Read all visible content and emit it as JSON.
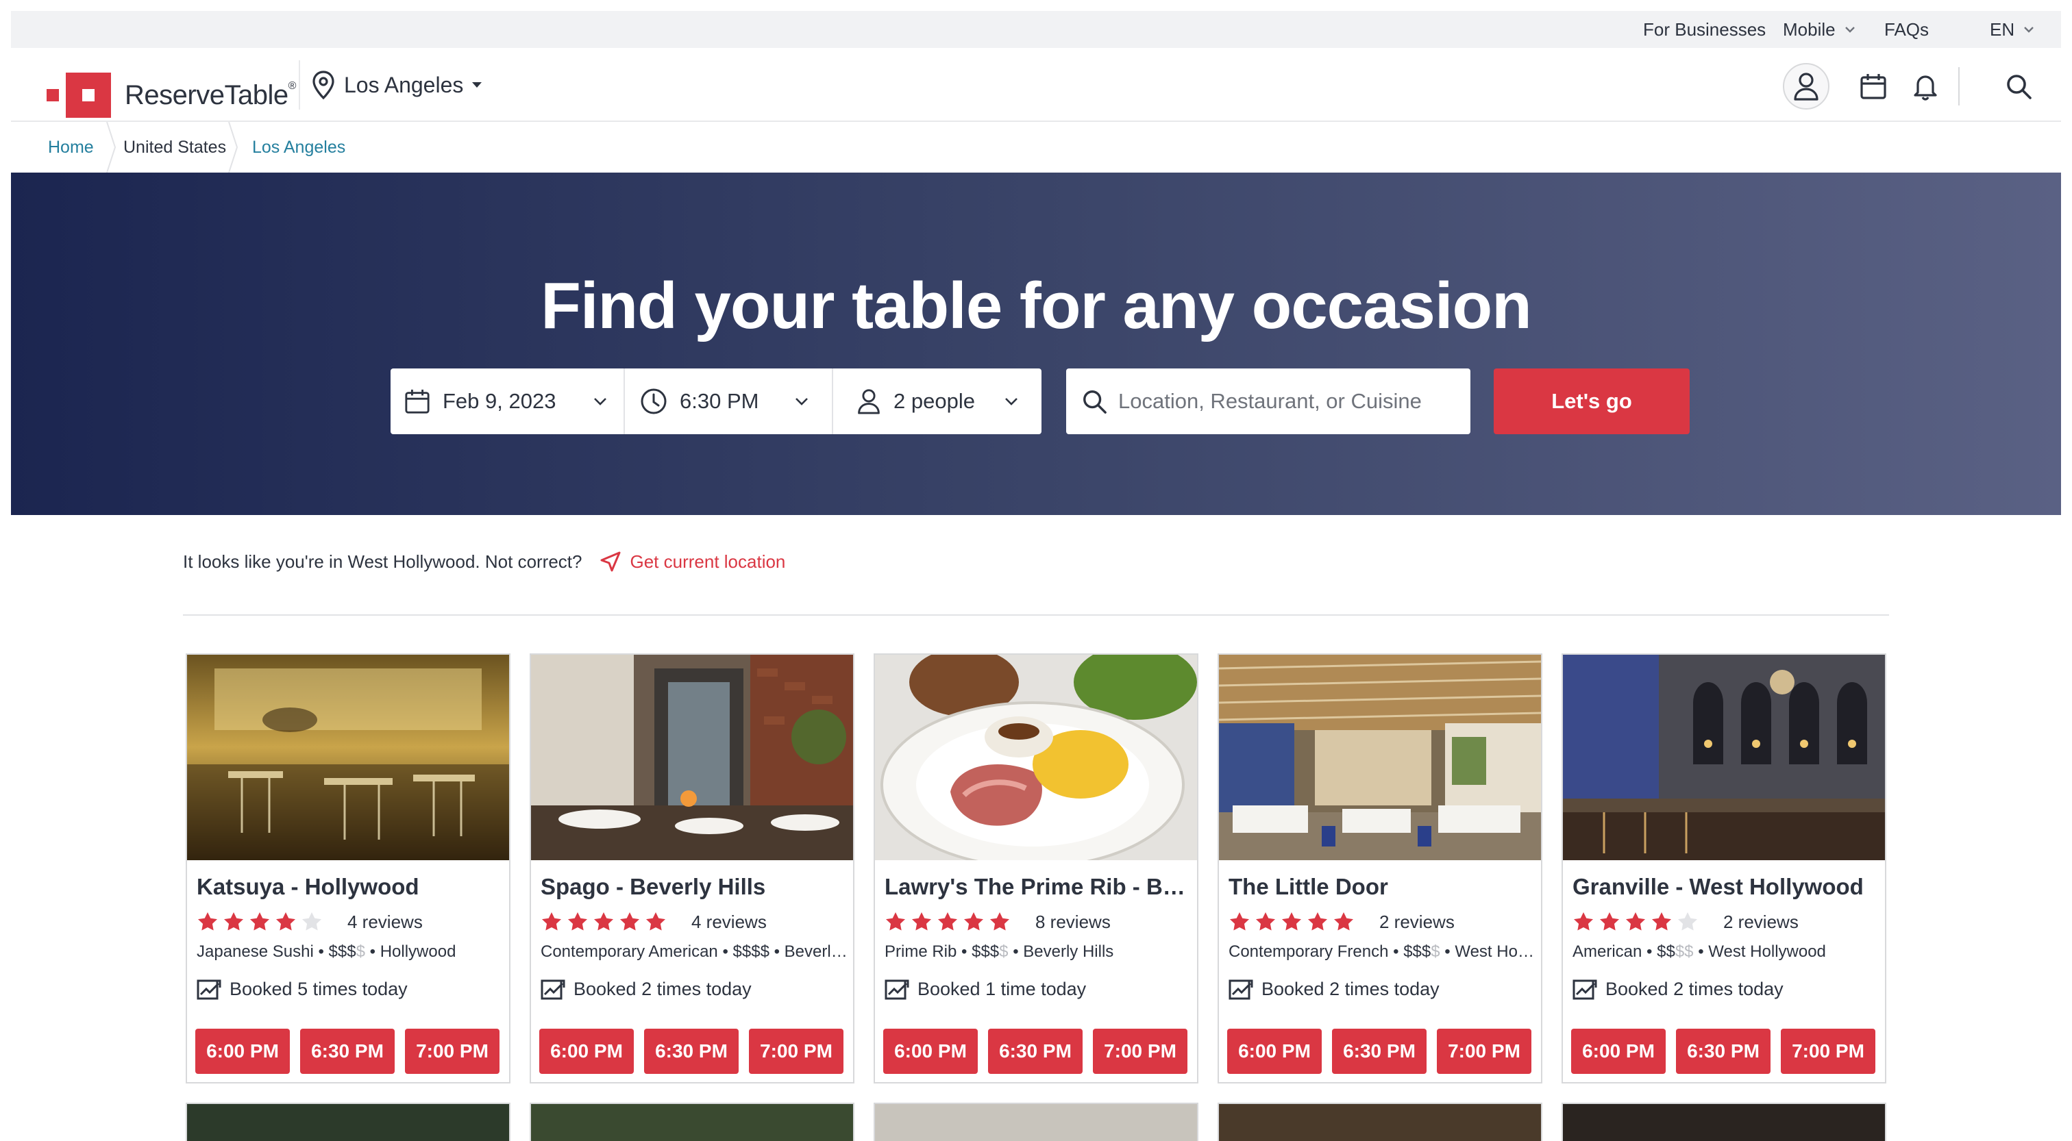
{
  "utility": {
    "for_businesses": "For Businesses",
    "mobile": "Mobile",
    "faqs": "FAQs",
    "language": "EN"
  },
  "header": {
    "brand": "ReserveTable",
    "brand_mark": "®",
    "location": "Los Angeles"
  },
  "breadcrumb": {
    "home": "Home",
    "country": "United States",
    "city": "Los Angeles"
  },
  "hero": {
    "title": "Find your table for any occasion",
    "date": "Feb 9, 2023",
    "time": "6:30 PM",
    "party": "2 people",
    "search_placeholder": "Location, Restaurant, or Cuisine",
    "go_label": "Let's go"
  },
  "location_notice": {
    "message": "It looks like you're in West Hollywood. Not correct?",
    "link": "Get current location"
  },
  "colors": {
    "brand_red": "#da3743",
    "link_blue": "#247f9e",
    "hero_dark": "#1b2550",
    "hero_light": "#5a6184"
  },
  "restaurants": [
    {
      "name": "Katsuya - Hollywood",
      "rating": 4,
      "reviews": "4 reviews",
      "cuisine": "Japanese Sushi",
      "price_on": "$$$",
      "price_off": "$",
      "area": "Hollywood",
      "booked": "Booked 5 times today",
      "times": [
        "6:00 PM",
        "6:30 PM",
        "7:00 PM"
      ]
    },
    {
      "name": "Spago - Beverly Hills",
      "rating": 5,
      "reviews": "4 reviews",
      "cuisine": "Contemporary American",
      "price_on": "$$$$",
      "price_off": "",
      "area": "Beverly Hills",
      "booked": "Booked 2 times today",
      "times": [
        "6:00 PM",
        "6:30 PM",
        "7:00 PM"
      ]
    },
    {
      "name": "Lawry's The Prime Rib - Beverly Hills",
      "rating": 5,
      "reviews": "8 reviews",
      "cuisine": "Prime Rib",
      "price_on": "$$$",
      "price_off": "$",
      "area": "Beverly Hills",
      "booked": "Booked 1 time today",
      "times": [
        "6:00 PM",
        "6:30 PM",
        "7:00 PM"
      ]
    },
    {
      "name": "The Little Door",
      "rating": 5,
      "reviews": "2 reviews",
      "cuisine": "Contemporary French",
      "price_on": "$$$",
      "price_off": "$",
      "area": "West Hollywood",
      "booked": "Booked 2 times today",
      "times": [
        "6:00 PM",
        "6:30 PM",
        "7:00 PM"
      ]
    },
    {
      "name": "Granville - West Hollywood",
      "rating": 4,
      "reviews": "2 reviews",
      "cuisine": "American",
      "price_on": "$$",
      "price_off": "$$",
      "area": "West Hollywood",
      "booked": "Booked 2 times today",
      "times": [
        "6:00 PM",
        "6:30 PM",
        "7:00 PM"
      ]
    }
  ]
}
